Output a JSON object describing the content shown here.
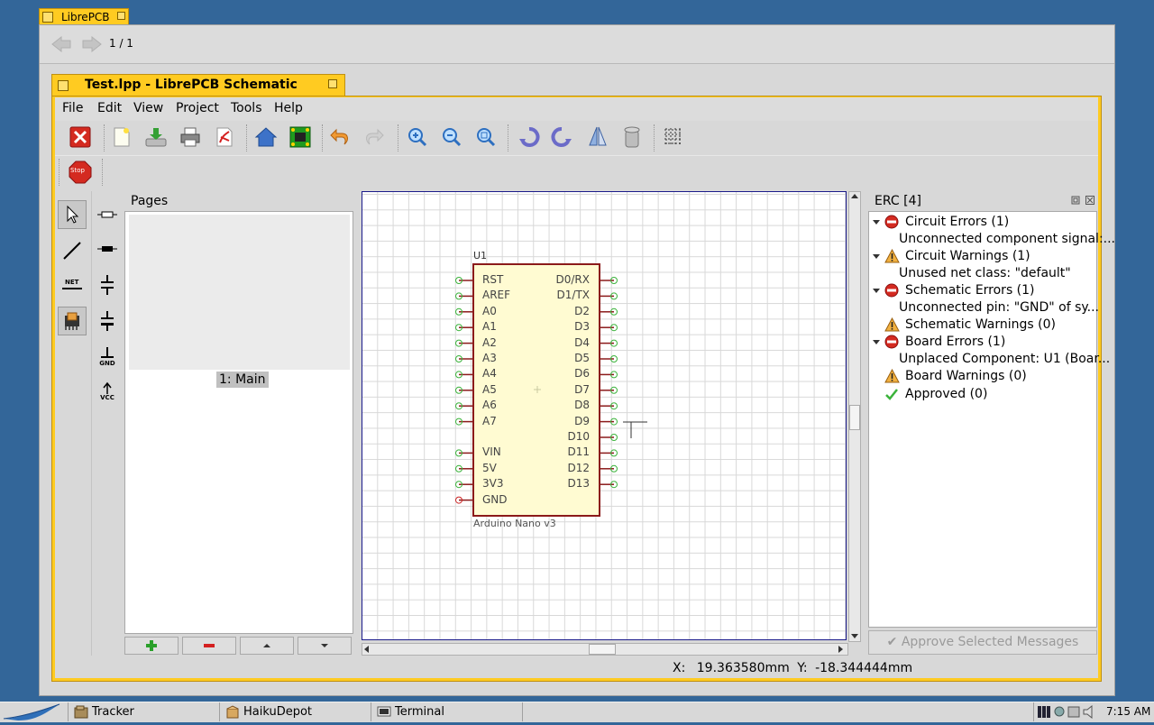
{
  "bg_window": {
    "tab_title": "LibrePCB",
    "page_indicator": "1 / 1"
  },
  "window": {
    "title": "Test.lpp - LibrePCB Schematic Editor"
  },
  "menu": [
    "File",
    "Edit",
    "View",
    "Project",
    "Tools",
    "Help"
  ],
  "toolbar": {
    "icons": [
      "close-project",
      "new-sheet",
      "save",
      "print",
      "export-pdf",
      "control-panel",
      "switch-to-board",
      "undo",
      "redo",
      "zoom-in",
      "zoom-out",
      "zoom-all",
      "rotate-ccw",
      "rotate-cw",
      "mirror",
      "remove",
      "grid"
    ],
    "stop_label": "Stop"
  },
  "tools": {
    "left": [
      "select",
      "draw-wire",
      "add-netlabel",
      "add-component"
    ],
    "right": [
      "resistor",
      "bipolar-resistor",
      "capacitor",
      "polarized-capacitor",
      "gnd-symbol",
      "vcc-symbol"
    ],
    "gnd_label": "GND",
    "vcc_label": "VCC",
    "net_label": "NET"
  },
  "pages": {
    "title": "Pages",
    "items": [
      "1: Main"
    ]
  },
  "schematic": {
    "component_name": "U1",
    "component_value": "Arduino Nano v3",
    "left_pins": [
      "RST",
      "AREF",
      "A0",
      "A1",
      "A2",
      "A3",
      "A4",
      "A5",
      "A6",
      "A7",
      "",
      "VIN",
      "5V",
      "3V3",
      "GND"
    ],
    "right_pins": [
      "D0/RX",
      "D1/TX",
      "D2",
      "D3",
      "D4",
      "D5",
      "D6",
      "D7",
      "D8",
      "D9",
      "D10",
      "D11",
      "D12",
      "D13"
    ],
    "unconnected_pin": "GND"
  },
  "erc": {
    "title": "ERC [4]",
    "rows": [
      {
        "type": "group",
        "icon": "error",
        "text": "Circuit Errors (1)"
      },
      {
        "type": "item",
        "text": "Unconnected component signal:..."
      },
      {
        "type": "group",
        "icon": "warning",
        "text": "Circuit Warnings (1)"
      },
      {
        "type": "item",
        "text": "Unused net class: \"default\""
      },
      {
        "type": "group",
        "icon": "error",
        "text": "Schematic Errors (1)"
      },
      {
        "type": "item",
        "text": "Unconnected pin: \"GND\" of sy..."
      },
      {
        "type": "leaf",
        "icon": "warning",
        "text": "Schematic Warnings (0)"
      },
      {
        "type": "group",
        "icon": "error",
        "text": "Board Errors (1)"
      },
      {
        "type": "item",
        "text": "Unplaced Component: U1 (Boar..."
      },
      {
        "type": "leaf",
        "icon": "warning",
        "text": "Board Warnings (0)"
      },
      {
        "type": "leaf",
        "icon": "approved",
        "text": "Approved (0)"
      }
    ],
    "approve_button": "Approve Selected Messages"
  },
  "status": {
    "x_label": "X:",
    "x_value": "19.363580mm",
    "y_label": "Y:",
    "y_value": "-18.344444mm"
  },
  "taskbar": {
    "items": [
      "Tracker",
      "HaikuDepot",
      "Terminal"
    ],
    "clock": "7:15 AM"
  },
  "colors": {
    "window_tab": "#ffcb21",
    "component_fill": "#fffbd2",
    "component_outline": "#8b1a1a",
    "pin_ok": "#3bb33b",
    "pin_unconnected": "#cc2222",
    "desktop": "#336699"
  }
}
